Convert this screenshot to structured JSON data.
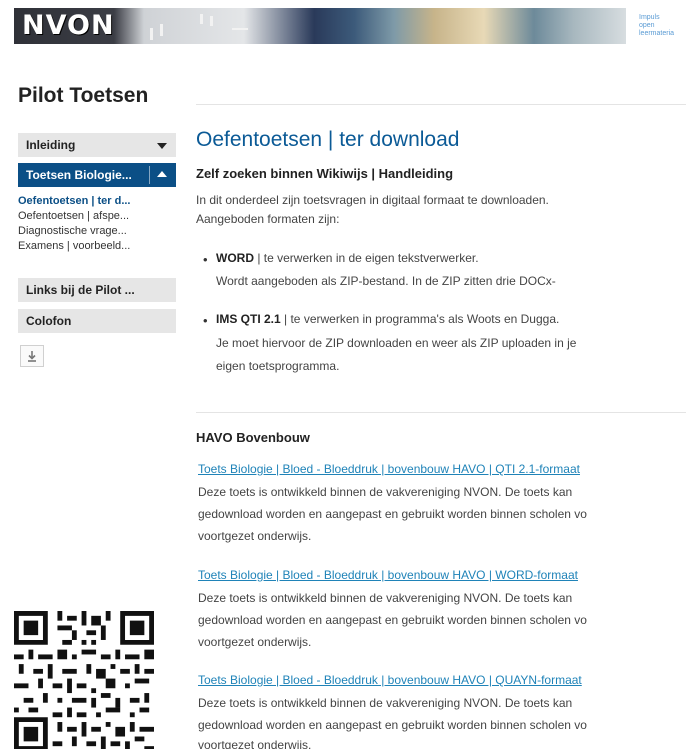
{
  "banner": {
    "logo_text": "NVON",
    "partner_text": [
      "Impuls",
      "open",
      "leermateria"
    ]
  },
  "sidebar": {
    "title": "Pilot Toetsen",
    "items": [
      {
        "label": "Inleiding",
        "state": "collapsed"
      },
      {
        "label": "Toetsen Biologie...",
        "state": "expanded"
      },
      {
        "label": "Links bij de Pilot ...",
        "state": "plain"
      },
      {
        "label": "Colofon",
        "state": "plain"
      }
    ],
    "sub_items": [
      {
        "label": "Oefentoetsen | ter d...",
        "active": true
      },
      {
        "label": "Oefentoetsen | afspe...",
        "active": false
      },
      {
        "label": "Diagnostische vrage...",
        "active": false
      },
      {
        "label": "Examens | voorbeeld...",
        "active": false
      }
    ],
    "download_icon": "download-icon",
    "qr_icon": "qr-code"
  },
  "main": {
    "title": "Oefentoetsen | ter download",
    "subtitle": "Zelf zoeken binnen Wikiwijs | Handleiding",
    "intro_lines": [
      "In dit onderdeel zijn toetsvragen in digitaal formaat te downloaden.",
      "Aangeboden formaten zijn:"
    ],
    "formats": [
      {
        "name": "WORD",
        "line1": " | te verwerken in de eigen tekstverwerker.",
        "line2": "Wordt aangeboden als ZIP-bestand. In de ZIP zitten drie DOCx-",
        "line3": ""
      },
      {
        "name": "IMS QTI 2.1",
        "line1": " | te verwerken in programma's als Woots en Dugga.",
        "line2": "Je moet hiervoor de ZIP downloaden en weer als ZIP uploaden in je",
        "line3": "eigen toetsprogramma."
      }
    ],
    "section_title": "HAVO Bovenbouw",
    "downloads": [
      {
        "link": "Toets Biologie | Bloed - Bloeddruk | bovenbouw HAVO | QTI 2.1-formaat",
        "desc": [
          "Deze toets is ontwikkeld binnen de vakvereniging NVON. De toets kan",
          "gedownload worden en aangepast en gebruikt worden binnen scholen vo",
          "voortgezet onderwijs."
        ]
      },
      {
        "link": "Toets Biologie | Bloed - Bloeddruk | bovenbouw HAVO | WORD-formaat",
        "desc": [
          "Deze toets is ontwikkeld binnen de vakvereniging NVON. De toets kan",
          "gedownload worden en aangepast en gebruikt worden binnen scholen vo",
          "voortgezet onderwijs."
        ]
      },
      {
        "link": "Toets Biologie | Bloed - Bloeddruk | bovenbouw HAVO | QUAYN-formaat",
        "desc": [
          "Deze toets is ontwikkeld binnen de vakvereniging NVON. De toets kan",
          "gedownload worden en aangepast en gebruikt worden binnen scholen vo",
          "voortgezet onderwijs."
        ]
      }
    ]
  },
  "colors": {
    "accent": "#0b4f86",
    "title": "#0b5a96",
    "link": "#1f83b8",
    "nav_grey": "#e6e6e6"
  }
}
